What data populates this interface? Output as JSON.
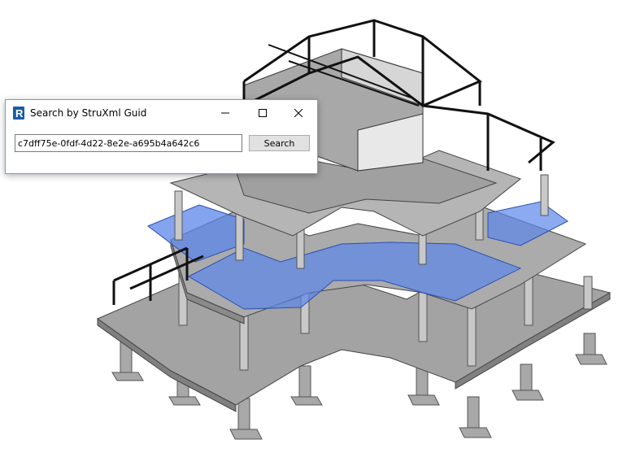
{
  "dialog": {
    "title": "Search by StruXml Guid",
    "app_icon": "revit-r-icon",
    "guid_value": "c7dff75e-0fdf-4d22-8e2e-a695b4a642c6",
    "search_label": "Search",
    "controls": {
      "minimize": "minimize-icon",
      "maximize": "maximize-icon",
      "close": "close-icon"
    }
  },
  "viewport": {
    "description_icon": "3d-structural-model",
    "colors": {
      "slab": "#9c9c9c",
      "slab_top": "#bdbdbd",
      "selected": "#5b86ea",
      "steel": "#111111",
      "background": "#ffffff"
    }
  }
}
